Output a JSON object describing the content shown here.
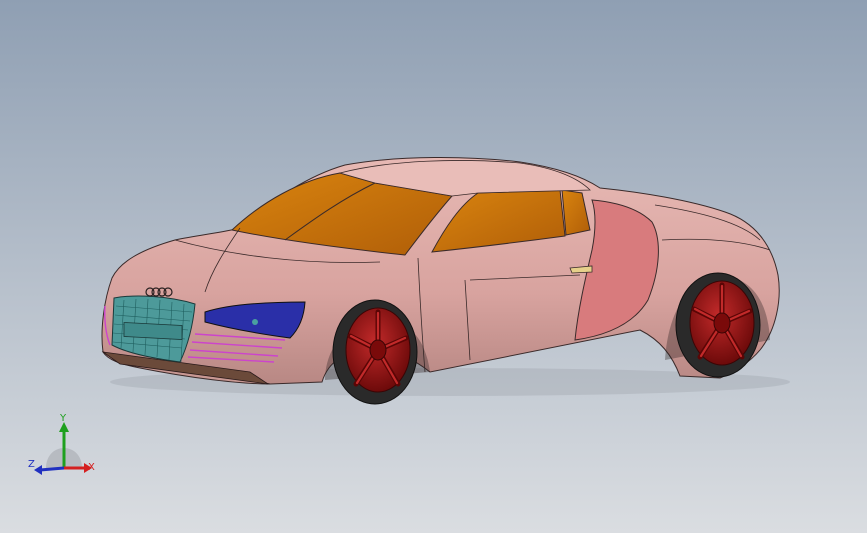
{
  "viewport": {
    "background_top": "#8f9fb3",
    "background_bottom": "#dadde1"
  },
  "model": {
    "body_color": "#d9a7a3",
    "glass_color": "#c97410",
    "wheel_color": "#8b1111",
    "tire_color": "#2a2a2a",
    "headlight_color": "#2a2fa8",
    "grille_color": "#4d9a9a",
    "side_blade_color": "#d87b7d",
    "trim_color": "#cc44cc",
    "edge_color": "#3a2a2a"
  },
  "triad": {
    "y_label": "Y",
    "x_label": "X",
    "z_label": "Z",
    "y_color": "#1ea01e",
    "x_color": "#d42020",
    "z_color": "#2030c0"
  }
}
